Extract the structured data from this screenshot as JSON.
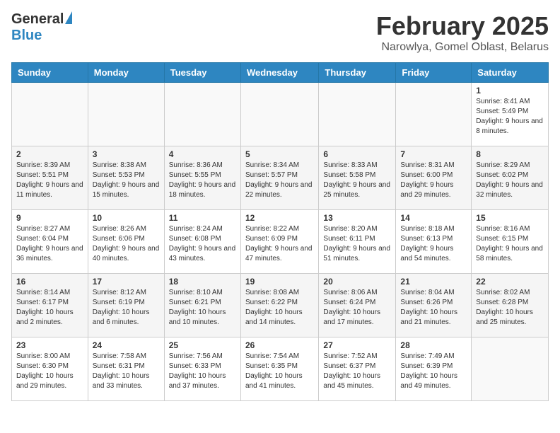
{
  "header": {
    "logo_general": "General",
    "logo_blue": "Blue",
    "main_title": "February 2025",
    "subtitle": "Narowlya, Gomel Oblast, Belarus"
  },
  "columns": [
    "Sunday",
    "Monday",
    "Tuesday",
    "Wednesday",
    "Thursday",
    "Friday",
    "Saturday"
  ],
  "weeks": [
    [
      {
        "day": "",
        "info": ""
      },
      {
        "day": "",
        "info": ""
      },
      {
        "day": "",
        "info": ""
      },
      {
        "day": "",
        "info": ""
      },
      {
        "day": "",
        "info": ""
      },
      {
        "day": "",
        "info": ""
      },
      {
        "day": "1",
        "info": "Sunrise: 8:41 AM\nSunset: 5:49 PM\nDaylight: 9 hours and 8 minutes."
      }
    ],
    [
      {
        "day": "2",
        "info": "Sunrise: 8:39 AM\nSunset: 5:51 PM\nDaylight: 9 hours and 11 minutes."
      },
      {
        "day": "3",
        "info": "Sunrise: 8:38 AM\nSunset: 5:53 PM\nDaylight: 9 hours and 15 minutes."
      },
      {
        "day": "4",
        "info": "Sunrise: 8:36 AM\nSunset: 5:55 PM\nDaylight: 9 hours and 18 minutes."
      },
      {
        "day": "5",
        "info": "Sunrise: 8:34 AM\nSunset: 5:57 PM\nDaylight: 9 hours and 22 minutes."
      },
      {
        "day": "6",
        "info": "Sunrise: 8:33 AM\nSunset: 5:58 PM\nDaylight: 9 hours and 25 minutes."
      },
      {
        "day": "7",
        "info": "Sunrise: 8:31 AM\nSunset: 6:00 PM\nDaylight: 9 hours and 29 minutes."
      },
      {
        "day": "8",
        "info": "Sunrise: 8:29 AM\nSunset: 6:02 PM\nDaylight: 9 hours and 32 minutes."
      }
    ],
    [
      {
        "day": "9",
        "info": "Sunrise: 8:27 AM\nSunset: 6:04 PM\nDaylight: 9 hours and 36 minutes."
      },
      {
        "day": "10",
        "info": "Sunrise: 8:26 AM\nSunset: 6:06 PM\nDaylight: 9 hours and 40 minutes."
      },
      {
        "day": "11",
        "info": "Sunrise: 8:24 AM\nSunset: 6:08 PM\nDaylight: 9 hours and 43 minutes."
      },
      {
        "day": "12",
        "info": "Sunrise: 8:22 AM\nSunset: 6:09 PM\nDaylight: 9 hours and 47 minutes."
      },
      {
        "day": "13",
        "info": "Sunrise: 8:20 AM\nSunset: 6:11 PM\nDaylight: 9 hours and 51 minutes."
      },
      {
        "day": "14",
        "info": "Sunrise: 8:18 AM\nSunset: 6:13 PM\nDaylight: 9 hours and 54 minutes."
      },
      {
        "day": "15",
        "info": "Sunrise: 8:16 AM\nSunset: 6:15 PM\nDaylight: 9 hours and 58 minutes."
      }
    ],
    [
      {
        "day": "16",
        "info": "Sunrise: 8:14 AM\nSunset: 6:17 PM\nDaylight: 10 hours and 2 minutes."
      },
      {
        "day": "17",
        "info": "Sunrise: 8:12 AM\nSunset: 6:19 PM\nDaylight: 10 hours and 6 minutes."
      },
      {
        "day": "18",
        "info": "Sunrise: 8:10 AM\nSunset: 6:21 PM\nDaylight: 10 hours and 10 minutes."
      },
      {
        "day": "19",
        "info": "Sunrise: 8:08 AM\nSunset: 6:22 PM\nDaylight: 10 hours and 14 minutes."
      },
      {
        "day": "20",
        "info": "Sunrise: 8:06 AM\nSunset: 6:24 PM\nDaylight: 10 hours and 17 minutes."
      },
      {
        "day": "21",
        "info": "Sunrise: 8:04 AM\nSunset: 6:26 PM\nDaylight: 10 hours and 21 minutes."
      },
      {
        "day": "22",
        "info": "Sunrise: 8:02 AM\nSunset: 6:28 PM\nDaylight: 10 hours and 25 minutes."
      }
    ],
    [
      {
        "day": "23",
        "info": "Sunrise: 8:00 AM\nSunset: 6:30 PM\nDaylight: 10 hours and 29 minutes."
      },
      {
        "day": "24",
        "info": "Sunrise: 7:58 AM\nSunset: 6:31 PM\nDaylight: 10 hours and 33 minutes."
      },
      {
        "day": "25",
        "info": "Sunrise: 7:56 AM\nSunset: 6:33 PM\nDaylight: 10 hours and 37 minutes."
      },
      {
        "day": "26",
        "info": "Sunrise: 7:54 AM\nSunset: 6:35 PM\nDaylight: 10 hours and 41 minutes."
      },
      {
        "day": "27",
        "info": "Sunrise: 7:52 AM\nSunset: 6:37 PM\nDaylight: 10 hours and 45 minutes."
      },
      {
        "day": "28",
        "info": "Sunrise: 7:49 AM\nSunset: 6:39 PM\nDaylight: 10 hours and 49 minutes."
      },
      {
        "day": "",
        "info": ""
      }
    ]
  ]
}
